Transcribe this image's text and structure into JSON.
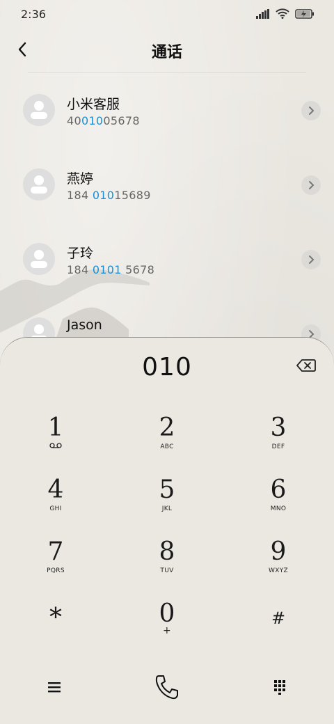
{
  "status": {
    "time": "2:36"
  },
  "header": {
    "title": "通话"
  },
  "contacts": [
    {
      "name": "小米客服",
      "number_pre": "40",
      "number_hl": "010",
      "number_post": "05678"
    },
    {
      "name": "燕婷",
      "number_pre": "184 ",
      "number_hl": "010",
      "number_post": "15689"
    },
    {
      "name": "子玲",
      "number_pre": "184 ",
      "number_hl": "0101",
      "number_post": " 5678"
    },
    {
      "name": "Jason",
      "number_pre": "",
      "number_hl": "",
      "number_post": ""
    }
  ],
  "dialpad": {
    "entered": "010",
    "keys": [
      {
        "digit": "1",
        "letters": ""
      },
      {
        "digit": "2",
        "letters": "ABC"
      },
      {
        "digit": "3",
        "letters": "DEF"
      },
      {
        "digit": "4",
        "letters": "GHI"
      },
      {
        "digit": "5",
        "letters": "JKL"
      },
      {
        "digit": "6",
        "letters": "MNO"
      },
      {
        "digit": "7",
        "letters": "PQRS"
      },
      {
        "digit": "8",
        "letters": "TUV"
      },
      {
        "digit": "9",
        "letters": "WXYZ"
      },
      {
        "digit": "*",
        "letters": ""
      },
      {
        "digit": "0",
        "letters": "+"
      },
      {
        "digit": "#",
        "letters": ""
      }
    ]
  },
  "colors": {
    "highlight": "#1a8fd6",
    "background": "#ebe8e2"
  }
}
